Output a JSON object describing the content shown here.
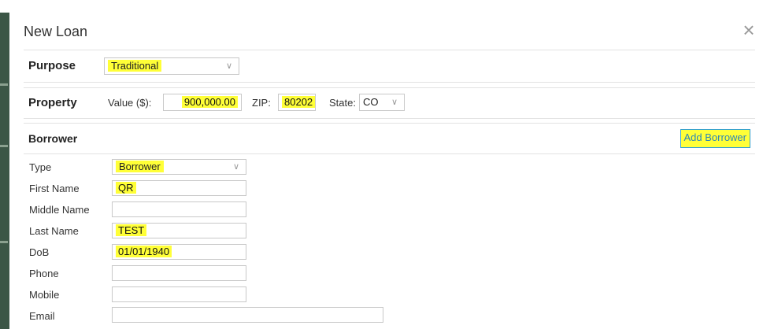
{
  "dialog": {
    "title": "New Loan"
  },
  "purpose": {
    "label": "Purpose",
    "selected": "Traditional"
  },
  "property": {
    "label": "Property",
    "value_label": "Value ($):",
    "value": "900,000.00",
    "zip_label": "ZIP:",
    "zip": "80202",
    "state_label": "State:",
    "state": "CO"
  },
  "borrower": {
    "label": "Borrower",
    "add_button": "Add Borrower",
    "fields": {
      "type": {
        "label": "Type",
        "value": "Borrower"
      },
      "first_name": {
        "label": "First Name",
        "value": "QR"
      },
      "middle_name": {
        "label": "Middle Name",
        "value": ""
      },
      "last_name": {
        "label": "Last Name",
        "value": "TEST"
      },
      "dob": {
        "label": "DoB",
        "value": "01/01/1940"
      },
      "phone": {
        "label": "Phone",
        "value": ""
      },
      "mobile": {
        "label": "Mobile",
        "value": ""
      },
      "email": {
        "label": "Email",
        "value": ""
      }
    }
  },
  "colors": {
    "highlight": "#ffff37",
    "accent": "#2c86b8",
    "background": "#2f4a3a"
  }
}
